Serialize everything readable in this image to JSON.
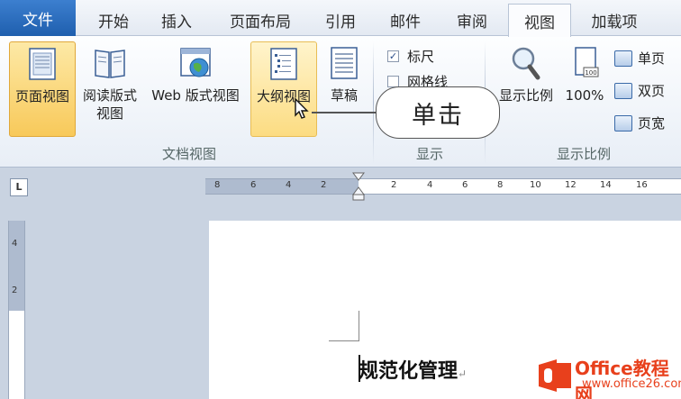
{
  "tabs": [
    {
      "label": "文件"
    },
    {
      "label": "开始"
    },
    {
      "label": "插入"
    },
    {
      "label": "页面布局"
    },
    {
      "label": "引用"
    },
    {
      "label": "邮件"
    },
    {
      "label": "审阅"
    },
    {
      "label": "视图"
    },
    {
      "label": "加载项"
    }
  ],
  "ribbon": {
    "doc_views": {
      "group_label": "文档视图",
      "print_layout": "页面视图",
      "reading_line1": "阅读版式",
      "reading_line2": "视图",
      "web_layout": "Web 版式视图",
      "outline": "大纲视图",
      "draft": "草稿"
    },
    "show": {
      "group_label": "显示",
      "ruler": "标尺",
      "gridlines": "网格线"
    },
    "zoom": {
      "group_label": "显示比例",
      "zoom_label": "显示比例",
      "percent": "100%",
      "one_page": "单页",
      "two_pages": "双页",
      "page_width": "页宽"
    }
  },
  "callout": "单击",
  "ruler": {
    "corner": "L",
    "h_numbers": [
      "8",
      "6",
      "4",
      "2",
      "2",
      "4",
      "6",
      "8",
      "10",
      "12",
      "14",
      "16"
    ],
    "v_numbers": [
      "4",
      "2"
    ]
  },
  "document": {
    "heading": "规范化管理"
  },
  "watermark": {
    "brand": "Office教程网",
    "url": "www.office26.com"
  },
  "colors": {
    "file_tab": "#2a6bbf",
    "active_button": "#f8c95a",
    "watermark_red": "#e8401c"
  }
}
